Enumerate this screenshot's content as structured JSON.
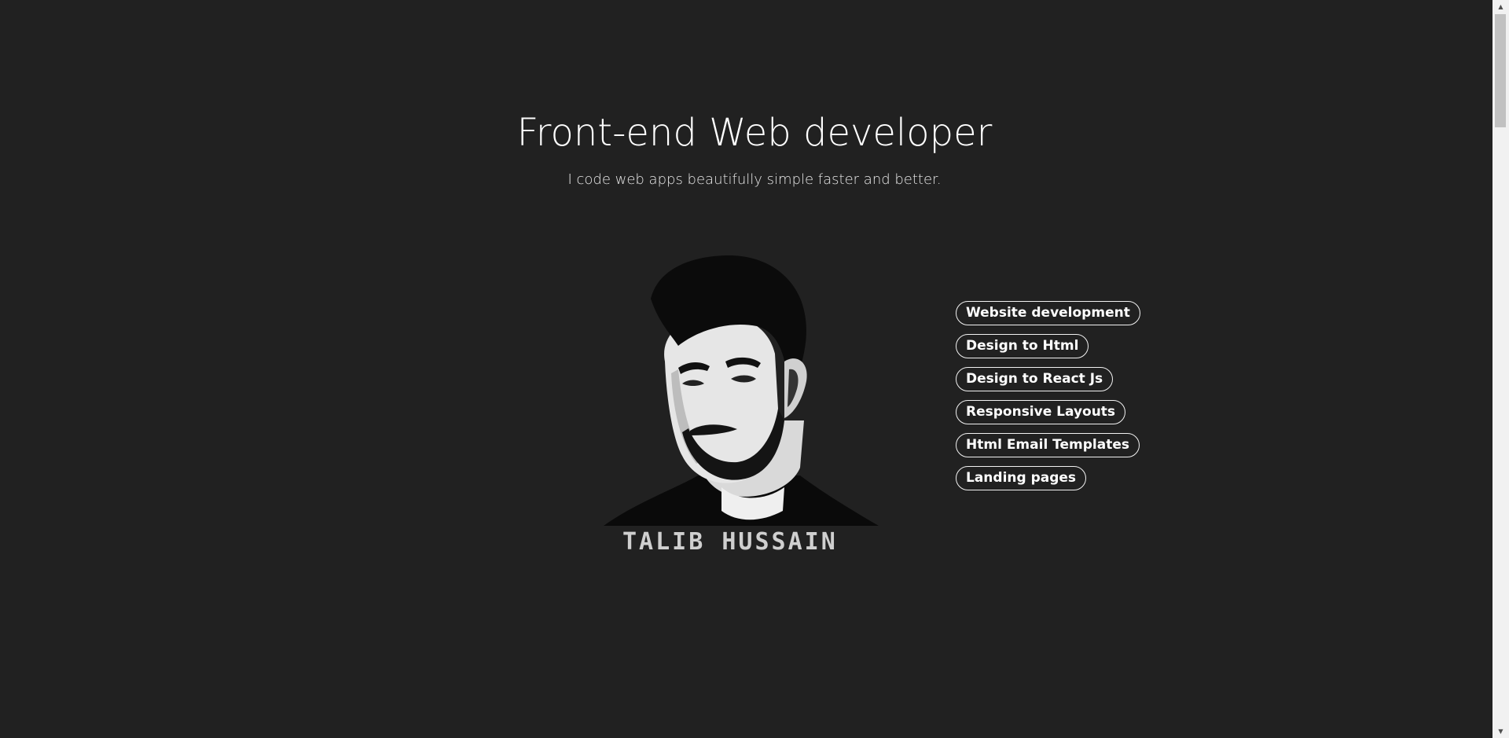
{
  "hero": {
    "title": "Front-end Web developer",
    "subtitle": "I code web apps beautifully simple faster and better."
  },
  "portrait": {
    "name_text": "TALIB HUSSAIN",
    "description": "black and white stylized portrait"
  },
  "skills": [
    "Website development",
    "Design to Html",
    "Design to React Js",
    "Responsive Layouts",
    "Html Email Templates",
    "Landing pages"
  ],
  "scrollbar": {
    "up_icon": "▲",
    "down_icon": "▼"
  },
  "colors": {
    "background": "#212121",
    "text": "#ffffff",
    "pill_border": "#f2f2f2"
  }
}
